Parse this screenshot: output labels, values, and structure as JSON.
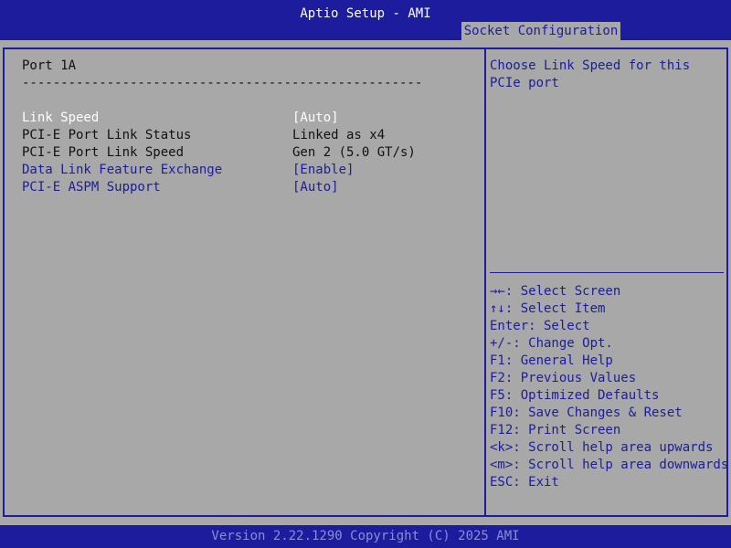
{
  "window": {
    "title": "Aptio Setup - AMI",
    "active_tab": "Socket Configuration"
  },
  "main": {
    "section_title": "Port 1A",
    "separator": "----------------------------------------------------",
    "items": [
      {
        "label": "Link Speed",
        "value": "[Auto]",
        "state": "highlighted"
      },
      {
        "label": "PCI-E Port Link Status",
        "value": "Linked as x4",
        "state": "readonly"
      },
      {
        "label": "PCI-E Port Link Speed",
        "value": "Gen 2 (5.0 GT/s)",
        "state": "readonly"
      },
      {
        "label": "Data Link Feature Exchange",
        "value": "[Enable]",
        "state": "selectable"
      },
      {
        "label": "PCI-E ASPM Support",
        "value": "[Auto]",
        "state": "selectable"
      }
    ]
  },
  "help": {
    "description_line1": "Choose Link Speed for this",
    "description_line2": "PCIe port",
    "keys": [
      "→←: Select Screen",
      "↑↓: Select Item",
      "Enter: Select",
      "+/-: Change Opt.",
      "F1: General Help",
      "F2: Previous Values",
      "F5: Optimized Defaults",
      "F10: Save Changes & Reset",
      "F12: Print Screen",
      "<k>: Scroll help area upwards",
      "<m>: Scroll help area downwards",
      "ESC: Exit"
    ]
  },
  "footer": {
    "version": "Version 2.22.1290 Copyright (C) 2025 AMI"
  },
  "colors": {
    "background": "#a8a8a8",
    "accent_blue": "#1c1c9c",
    "text": "#111111",
    "highlight_text": "#ffffff",
    "footer_text": "#8c8cd8"
  }
}
